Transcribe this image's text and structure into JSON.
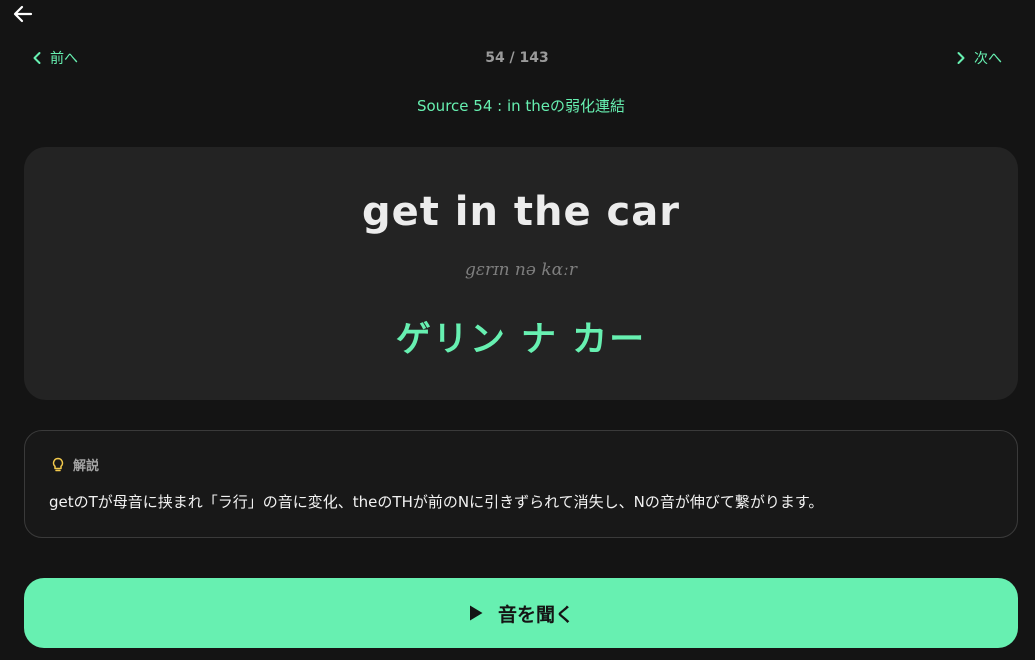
{
  "header": {
    "back_icon": "arrow-left-icon"
  },
  "nav": {
    "prev_label": "前へ",
    "next_label": "次へ",
    "counter": "54 / 143"
  },
  "source": {
    "title": "Source 54 : in theの弱化連結"
  },
  "card": {
    "phrase": "get in the car",
    "ipa": "gɛrɪn nə kɑːr",
    "katakana": "ゲリン ナ カー"
  },
  "explanation": {
    "label": "解説",
    "text": "getのTが母音に挟まれ「ラ行」の音に変化、theのTHが前のNに引きずられて消失し、Nの音が伸びて繋がります。"
  },
  "play": {
    "label": "音を聞く"
  },
  "colors": {
    "background": "#141414",
    "accent": "#67f0b1",
    "card": "#232323",
    "bulb": "#f2c94c"
  }
}
